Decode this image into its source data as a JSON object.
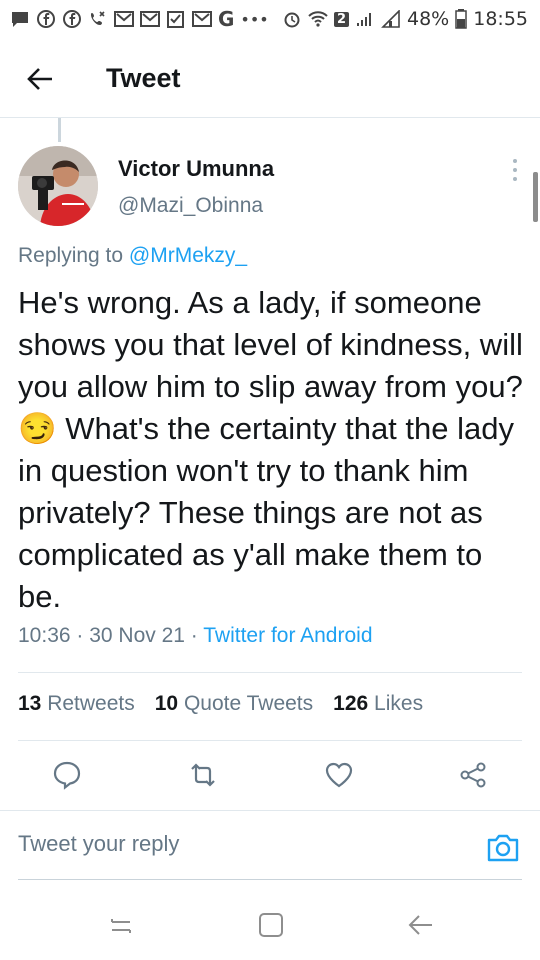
{
  "status_bar": {
    "battery": "48%",
    "time": "18:55",
    "sim_badge": "2",
    "dots": "•••",
    "g_label": "G",
    "icons": [
      "chat-icon",
      "facebook-icon",
      "facebook-icon",
      "missed-call-icon",
      "gmail-icon",
      "gmail-icon",
      "checkbox-icon",
      "gmail-icon",
      "g-icon",
      "more-dots-icon",
      "alarm-icon",
      "wifi-icon",
      "signal-icon",
      "battery-icon"
    ]
  },
  "header": {
    "title": "Tweet",
    "back_icon": "arrow-left-icon"
  },
  "tweet": {
    "author_name": "Victor Umunna",
    "author_handle": "@Mazi_Obinna",
    "replying_prefix": "Replying to ",
    "replying_to": "@MrMekzy_",
    "text_part1": "He's wrong. As a lady, if someone shows you that level of kindness, will you allow him to slip away from you? ",
    "emoji": "😏",
    "text_part2": " What's the certainty that the lady in question won't try to thank him privately? These things are not as complicated as y'all make them to be.",
    "time": "10:36",
    "date": "30 Nov 21",
    "separator": " · ",
    "source": "Twitter for Android"
  },
  "stats": {
    "retweets_count": "13",
    "retweets_label": "Retweets",
    "quotes_count": "10",
    "quotes_label": "Quote Tweets",
    "likes_count": "126",
    "likes_label": "Likes"
  },
  "actions": [
    "reply-icon",
    "retweet-icon",
    "like-icon",
    "share-icon"
  ],
  "reply": {
    "placeholder": "Tweet your reply"
  },
  "colors": {
    "accent": "#1da1f2",
    "secondary_text": "#657786",
    "primary_text": "#14171a",
    "divider": "#e1e8ed"
  }
}
